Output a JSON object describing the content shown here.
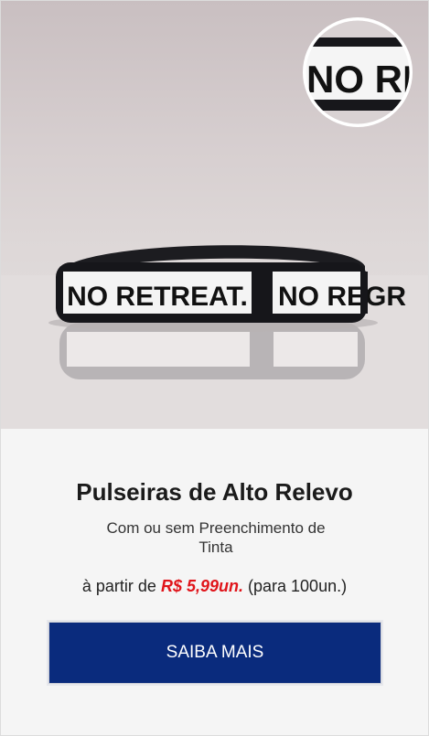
{
  "product": {
    "image": {
      "band_text_left": "NO RETREAT.",
      "band_text_right": "NO REGR",
      "zoom_text": "NO RET"
    },
    "title": "Pulseiras de Alto Relevo",
    "subtitle": "Com ou sem Preenchimento de Tinta",
    "price_prefix": "à partir de",
    "price": "R$ 5,99un.",
    "price_suffix": "(para 100un.)",
    "cta_label": "SAIBA MAIS"
  },
  "colors": {
    "cta_background": "#0a2b7d",
    "price": "#e0151b"
  }
}
